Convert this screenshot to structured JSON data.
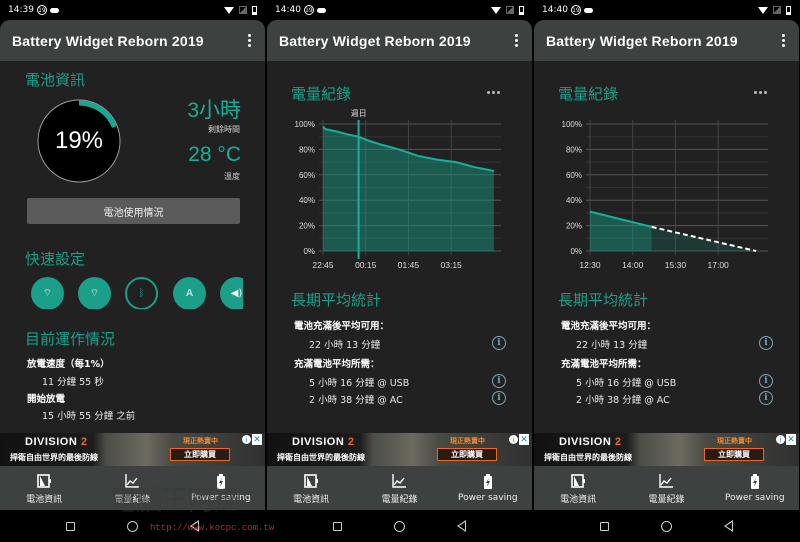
{
  "app": {
    "title": "Battery Widget Reborn 2019"
  },
  "colors": {
    "accent": "#1b9e8a",
    "line": "#16b09a",
    "appbar": "#3d4241",
    "background": "#212121",
    "info": "#7aa5b7"
  },
  "screens": [
    {
      "status": {
        "time": "14:39",
        "badge": "19"
      },
      "battery_info": {
        "title": "電池資訊",
        "level_text": "19%",
        "level_fraction": 0.19,
        "remaining_value": "3小時",
        "remaining_label": "剩餘時間",
        "temperature_value": "28 °C",
        "temperature_label": "溫度",
        "usage_button": "電池使用情況"
      },
      "quick_settings": {
        "title": "快速設定",
        "toggles": [
          {
            "icon": "wifi-icon",
            "glyph": "⌔",
            "active": true
          },
          {
            "icon": "wifi-hotspot-icon",
            "glyph": "⌔",
            "active": true
          },
          {
            "icon": "bluetooth-icon",
            "glyph": "ᛒ",
            "active": false
          },
          {
            "icon": "auto-brightness-icon",
            "glyph": "A",
            "active": true
          },
          {
            "icon": "volume-icon",
            "glyph": "◀)",
            "active": true
          }
        ]
      },
      "current_status": {
        "title": "目前運作情況",
        "items": [
          {
            "label": "放電速度（每1%）",
            "value": "11 分鐘 55 秒"
          },
          {
            "label": "開始放電",
            "value": "15 小時 55 分鐘 之前"
          }
        ]
      }
    },
    {
      "status": {
        "time": "14:40",
        "badge": "19"
      },
      "chart_title": "電量紀錄",
      "long_term": {
        "title": "長期平均統計",
        "avail_label": "電池充滿後平均可用：",
        "avail_value": "22 小時 13 分鐘",
        "charge_label": "充滿電池平均所需：",
        "usb_value": "5 小時 16 分鐘 @ USB",
        "ac_value": "2 小時 38 分鐘 @ AC"
      }
    },
    {
      "status": {
        "time": "14:40",
        "badge": "19"
      },
      "chart_title": "電量紀錄",
      "long_term": {
        "title": "長期平均統計",
        "avail_label": "電池充滿後平均可用：",
        "avail_value": "22 小時 13 分鐘",
        "charge_label": "充滿電池平均所需：",
        "usb_value": "5 小時 16 分鐘 @ USB",
        "ac_value": "2 小時 38 分鐘 @ AC"
      }
    }
  ],
  "chart_data": [
    {
      "type": "area",
      "title": "電量紀錄",
      "y_ticks": [
        "100%",
        "80%",
        "60%",
        "40%",
        "20%",
        "0%"
      ],
      "ylim": [
        0,
        100
      ],
      "x_ticks": [
        "22:45",
        "00:15",
        "01:45",
        "03:15"
      ],
      "x_minutes_from_start": [
        0,
        90,
        180,
        270
      ],
      "xlim_minutes": [
        0,
        375
      ],
      "marker": {
        "label": "週日",
        "x_minutes": 75
      },
      "grid": true,
      "series": [
        {
          "name": "battery",
          "x": [
            0,
            5,
            30,
            50,
            75,
            95,
            120,
            160,
            200,
            240,
            280,
            320,
            360
          ],
          "y": [
            98,
            96,
            94,
            92,
            90,
            87,
            84,
            80,
            75,
            72,
            70,
            66,
            63
          ]
        }
      ]
    },
    {
      "type": "area",
      "title": "電量紀錄",
      "y_ticks": [
        "100%",
        "80%",
        "60%",
        "40%",
        "20%",
        "0%"
      ],
      "ylim": [
        0,
        100
      ],
      "x_ticks": [
        "12:30",
        "14:00",
        "15:30",
        "17:00"
      ],
      "x_minutes_from_start": [
        0,
        90,
        180,
        270
      ],
      "xlim_minutes": [
        0,
        375
      ],
      "grid": true,
      "series": [
        {
          "name": "measured",
          "x": [
            0,
            130
          ],
          "y": [
            31,
            19
          ]
        },
        {
          "name": "predicted",
          "x": [
            130,
            350
          ],
          "y": [
            19,
            0
          ],
          "dashed": true
        }
      ]
    }
  ],
  "ad": {
    "logo": "DIVISION",
    "logo_num": "2",
    "slogan": "捍衛自由世界的最後防線",
    "sale": "現正熱賣中",
    "buy_button": "立即購買",
    "info": "i",
    "close": "✕"
  },
  "bottom_nav": [
    {
      "label": "電池資訊",
      "icon": "battery-info-icon"
    },
    {
      "label": "電量紀錄",
      "icon": "chart-icon"
    },
    {
      "label": "Power saving",
      "icon": "power-saving-icon"
    }
  ],
  "watermark": {
    "text": "電腦王阿達",
    "url": "http://www.kocpc.com.tw"
  }
}
